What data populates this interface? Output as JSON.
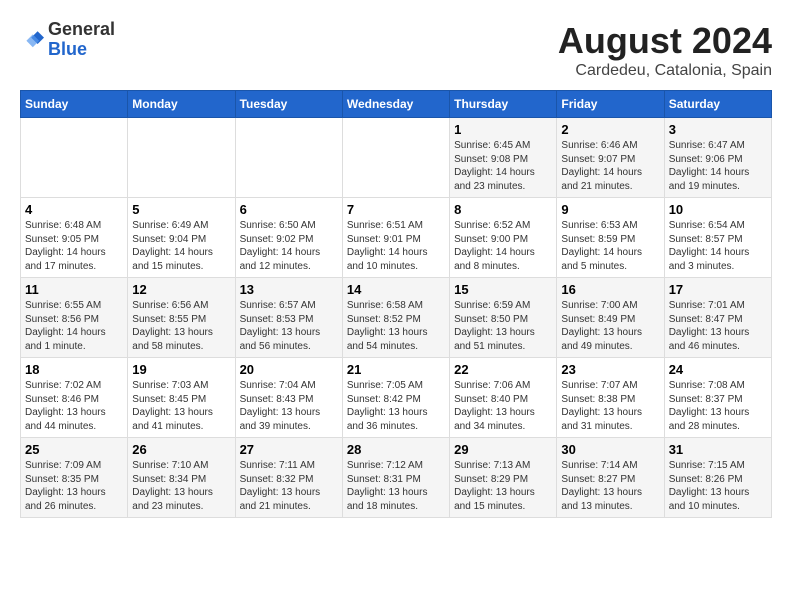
{
  "header": {
    "logo_line1": "General",
    "logo_line2": "Blue",
    "main_title": "August 2024",
    "subtitle": "Cardedeu, Catalonia, Spain"
  },
  "days_of_week": [
    "Sunday",
    "Monday",
    "Tuesday",
    "Wednesday",
    "Thursday",
    "Friday",
    "Saturday"
  ],
  "weeks": [
    [
      {
        "day": "",
        "content": ""
      },
      {
        "day": "",
        "content": ""
      },
      {
        "day": "",
        "content": ""
      },
      {
        "day": "",
        "content": ""
      },
      {
        "day": "1",
        "content": "Sunrise: 6:45 AM\nSunset: 9:08 PM\nDaylight: 14 hours\nand 23 minutes."
      },
      {
        "day": "2",
        "content": "Sunrise: 6:46 AM\nSunset: 9:07 PM\nDaylight: 14 hours\nand 21 minutes."
      },
      {
        "day": "3",
        "content": "Sunrise: 6:47 AM\nSunset: 9:06 PM\nDaylight: 14 hours\nand 19 minutes."
      }
    ],
    [
      {
        "day": "4",
        "content": "Sunrise: 6:48 AM\nSunset: 9:05 PM\nDaylight: 14 hours\nand 17 minutes."
      },
      {
        "day": "5",
        "content": "Sunrise: 6:49 AM\nSunset: 9:04 PM\nDaylight: 14 hours\nand 15 minutes."
      },
      {
        "day": "6",
        "content": "Sunrise: 6:50 AM\nSunset: 9:02 PM\nDaylight: 14 hours\nand 12 minutes."
      },
      {
        "day": "7",
        "content": "Sunrise: 6:51 AM\nSunset: 9:01 PM\nDaylight: 14 hours\nand 10 minutes."
      },
      {
        "day": "8",
        "content": "Sunrise: 6:52 AM\nSunset: 9:00 PM\nDaylight: 14 hours\nand 8 minutes."
      },
      {
        "day": "9",
        "content": "Sunrise: 6:53 AM\nSunset: 8:59 PM\nDaylight: 14 hours\nand 5 minutes."
      },
      {
        "day": "10",
        "content": "Sunrise: 6:54 AM\nSunset: 8:57 PM\nDaylight: 14 hours\nand 3 minutes."
      }
    ],
    [
      {
        "day": "11",
        "content": "Sunrise: 6:55 AM\nSunset: 8:56 PM\nDaylight: 14 hours\nand 1 minute."
      },
      {
        "day": "12",
        "content": "Sunrise: 6:56 AM\nSunset: 8:55 PM\nDaylight: 13 hours\nand 58 minutes."
      },
      {
        "day": "13",
        "content": "Sunrise: 6:57 AM\nSunset: 8:53 PM\nDaylight: 13 hours\nand 56 minutes."
      },
      {
        "day": "14",
        "content": "Sunrise: 6:58 AM\nSunset: 8:52 PM\nDaylight: 13 hours\nand 54 minutes."
      },
      {
        "day": "15",
        "content": "Sunrise: 6:59 AM\nSunset: 8:50 PM\nDaylight: 13 hours\nand 51 minutes."
      },
      {
        "day": "16",
        "content": "Sunrise: 7:00 AM\nSunset: 8:49 PM\nDaylight: 13 hours\nand 49 minutes."
      },
      {
        "day": "17",
        "content": "Sunrise: 7:01 AM\nSunset: 8:47 PM\nDaylight: 13 hours\nand 46 minutes."
      }
    ],
    [
      {
        "day": "18",
        "content": "Sunrise: 7:02 AM\nSunset: 8:46 PM\nDaylight: 13 hours\nand 44 minutes."
      },
      {
        "day": "19",
        "content": "Sunrise: 7:03 AM\nSunset: 8:45 PM\nDaylight: 13 hours\nand 41 minutes."
      },
      {
        "day": "20",
        "content": "Sunrise: 7:04 AM\nSunset: 8:43 PM\nDaylight: 13 hours\nand 39 minutes."
      },
      {
        "day": "21",
        "content": "Sunrise: 7:05 AM\nSunset: 8:42 PM\nDaylight: 13 hours\nand 36 minutes."
      },
      {
        "day": "22",
        "content": "Sunrise: 7:06 AM\nSunset: 8:40 PM\nDaylight: 13 hours\nand 34 minutes."
      },
      {
        "day": "23",
        "content": "Sunrise: 7:07 AM\nSunset: 8:38 PM\nDaylight: 13 hours\nand 31 minutes."
      },
      {
        "day": "24",
        "content": "Sunrise: 7:08 AM\nSunset: 8:37 PM\nDaylight: 13 hours\nand 28 minutes."
      }
    ],
    [
      {
        "day": "25",
        "content": "Sunrise: 7:09 AM\nSunset: 8:35 PM\nDaylight: 13 hours\nand 26 minutes."
      },
      {
        "day": "26",
        "content": "Sunrise: 7:10 AM\nSunset: 8:34 PM\nDaylight: 13 hours\nand 23 minutes."
      },
      {
        "day": "27",
        "content": "Sunrise: 7:11 AM\nSunset: 8:32 PM\nDaylight: 13 hours\nand 21 minutes."
      },
      {
        "day": "28",
        "content": "Sunrise: 7:12 AM\nSunset: 8:31 PM\nDaylight: 13 hours\nand 18 minutes."
      },
      {
        "day": "29",
        "content": "Sunrise: 7:13 AM\nSunset: 8:29 PM\nDaylight: 13 hours\nand 15 minutes."
      },
      {
        "day": "30",
        "content": "Sunrise: 7:14 AM\nSunset: 8:27 PM\nDaylight: 13 hours\nand 13 minutes."
      },
      {
        "day": "31",
        "content": "Sunrise: 7:15 AM\nSunset: 8:26 PM\nDaylight: 13 hours\nand 10 minutes."
      }
    ]
  ]
}
